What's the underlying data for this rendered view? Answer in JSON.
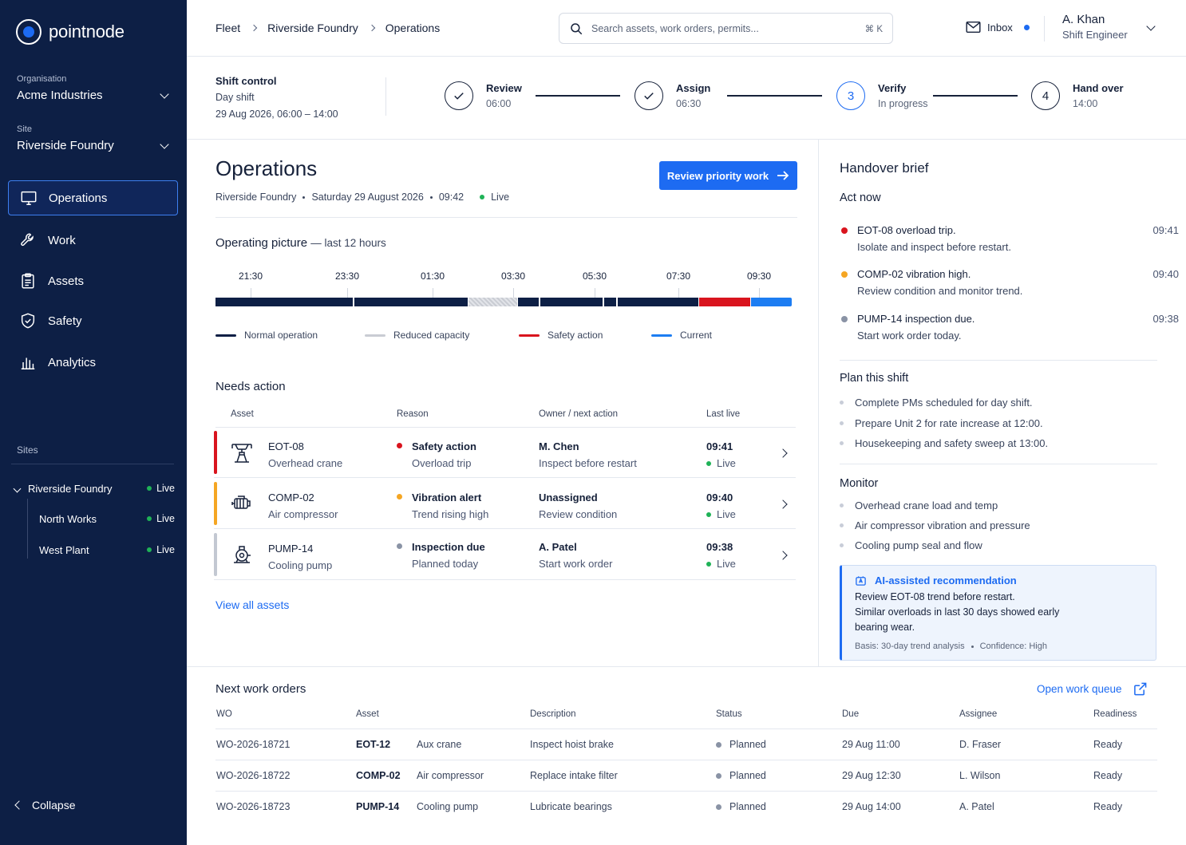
{
  "app": {
    "name": "pointnode"
  },
  "sidebar": {
    "org": {
      "caption": "Organisation",
      "value": "Acme Industries"
    },
    "site": {
      "caption": "Site",
      "value": "Riverside Foundry"
    },
    "nav": [
      {
        "label": "Operations",
        "icon": "monitor-icon",
        "active": true
      },
      {
        "label": "Work",
        "icon": "wrench-icon"
      },
      {
        "label": "Assets",
        "icon": "clipboard-icon"
      },
      {
        "label": "Safety",
        "icon": "shield-icon"
      },
      {
        "label": "Analytics",
        "icon": "bar-chart-icon"
      }
    ],
    "sites_caption": "Sites",
    "sites": [
      {
        "name": "Riverside Foundry",
        "status": "Live"
      },
      {
        "name": "North Works",
        "status": "Live"
      },
      {
        "name": "West Plant",
        "status": "Live"
      }
    ],
    "collapse_label": "Collapse"
  },
  "header": {
    "breadcrumbs": [
      "Fleet",
      "Riverside Foundry",
      "Operations"
    ],
    "search_placeholder": "Search assets, work orders, permits...",
    "search_shortcut": "⌘ K",
    "inbox_label": "Inbox",
    "user": {
      "name": "A. Khan",
      "role": "Shift Engineer"
    }
  },
  "shift": {
    "title": "Shift control",
    "name": "Day shift",
    "window": "29 Aug 2026, 06:00 – 14:00",
    "steps": [
      {
        "num": "1",
        "label": "Review",
        "sub": "06:00",
        "state": "done"
      },
      {
        "num": "2",
        "label": "Assign",
        "sub": "06:30",
        "state": "done"
      },
      {
        "num": "3",
        "label": "Verify",
        "sub": "In progress",
        "state": "current"
      },
      {
        "num": "4",
        "label": "Hand over",
        "sub": "14:00",
        "state": "pending"
      }
    ]
  },
  "main": {
    "title": "Operations",
    "meta": {
      "site": "Riverside Foundry",
      "date": "Saturday 29 August 2026",
      "time": "09:42",
      "status": "Live"
    },
    "primary_button": "Review priority work",
    "operating_picture": {
      "title": "Operating picture",
      "sub": "— last 12 hours",
      "ticks": [
        "21:30",
        "23:30",
        "01:30",
        "03:30",
        "05:30",
        "07:30",
        "09:30"
      ],
      "legend": [
        {
          "label": "Normal operation",
          "color": "#0d1f45"
        },
        {
          "label": "Reduced capacity",
          "color": "#c9ccd3"
        },
        {
          "label": "Safety action",
          "color": "#d9141e"
        },
        {
          "label": "Current",
          "color": "#1d7df2"
        }
      ]
    },
    "needs_action": {
      "title": "Needs action",
      "columns": [
        "Asset",
        "Reason",
        "Owner / next action",
        "Last live"
      ],
      "rows": [
        {
          "asset": "EOT-08",
          "asset_type": "Overhead crane",
          "icon": "crane-icon",
          "severity_color": "#d9141e",
          "reason": "Safety action",
          "reason_sub": "Overload trip",
          "owner": "M. Chen",
          "next": "Inspect before restart",
          "time": "09:41",
          "status": "Live"
        },
        {
          "asset": "COMP-02",
          "asset_type": "Air compressor",
          "icon": "compressor-icon",
          "severity_color": "#f5a623",
          "reason": "Vibration alert",
          "reason_sub": "Trend rising high",
          "owner": "Unassigned",
          "next": "Review condition",
          "time": "09:40",
          "status": "Live"
        },
        {
          "asset": "PUMP-14",
          "asset_type": "Cooling pump",
          "icon": "pump-icon",
          "severity_color": "#8a93a5",
          "reason": "Inspection due",
          "reason_sub": "Planned today",
          "owner": "A. Patel",
          "next": "Start work order",
          "time": "09:38",
          "status": "Live"
        }
      ],
      "view_all": "View all assets"
    }
  },
  "handover": {
    "title": "Handover brief",
    "act_now": {
      "title": "Act now",
      "items": [
        {
          "headline": "EOT-08 overload trip.",
          "detail": "Isolate and inspect before restart.",
          "time": "09:41",
          "color": "#d9141e"
        },
        {
          "headline": "COMP-02 vibration high.",
          "detail": "Review condition and monitor trend.",
          "time": "09:40",
          "color": "#f5a623"
        },
        {
          "headline": "PUMP-14 inspection due.",
          "detail": "Start work order today.",
          "time": "09:38",
          "color": "#8a93a5"
        }
      ]
    },
    "plan": {
      "title": "Plan this shift",
      "items": [
        "Complete PMs scheduled for day shift.",
        "Prepare Unit 2 for rate increase at 12:00.",
        "Housekeeping and safety sweep at 13:00."
      ]
    },
    "monitor": {
      "title": "Monitor",
      "items": [
        "Overhead crane load and temp",
        "Air compressor vibration and pressure",
        "Cooling pump seal and flow"
      ]
    },
    "ai": {
      "title": "AI-assisted recommendation",
      "line1": "Review EOT-08 trend before restart.",
      "line2": "Similar overloads in last 30 days showed early",
      "line3": "bearing wear.",
      "basis": "Basis: 30-day trend analysis",
      "confidence": "Confidence: High"
    }
  },
  "work_orders": {
    "title": "Next work orders",
    "open_link": "Open work queue",
    "columns": [
      "WO",
      "Asset",
      "Description",
      "Status",
      "Due",
      "Assignee",
      "Readiness"
    ],
    "rows": [
      {
        "wo": "WO-2026-18721",
        "asset": "EOT-12",
        "asset_type": "Aux crane",
        "description": "Inspect hoist brake",
        "status": "Planned",
        "due": "29 Aug 11:00",
        "assignee": "D. Fraser",
        "readiness": "Ready"
      },
      {
        "wo": "WO-2026-18722",
        "asset": "COMP-02",
        "asset_type": "Air compressor",
        "description": "Replace intake filter",
        "status": "Planned",
        "due": "29 Aug 12:30",
        "assignee": "L. Wilson",
        "readiness": "Ready"
      },
      {
        "wo": "WO-2026-18723",
        "asset": "PUMP-14",
        "asset_type": "Cooling pump",
        "description": "Lubricate bearings",
        "status": "Planned",
        "due": "29 Aug 14:00",
        "assignee": "A. Patel",
        "readiness": "Ready"
      }
    ]
  }
}
